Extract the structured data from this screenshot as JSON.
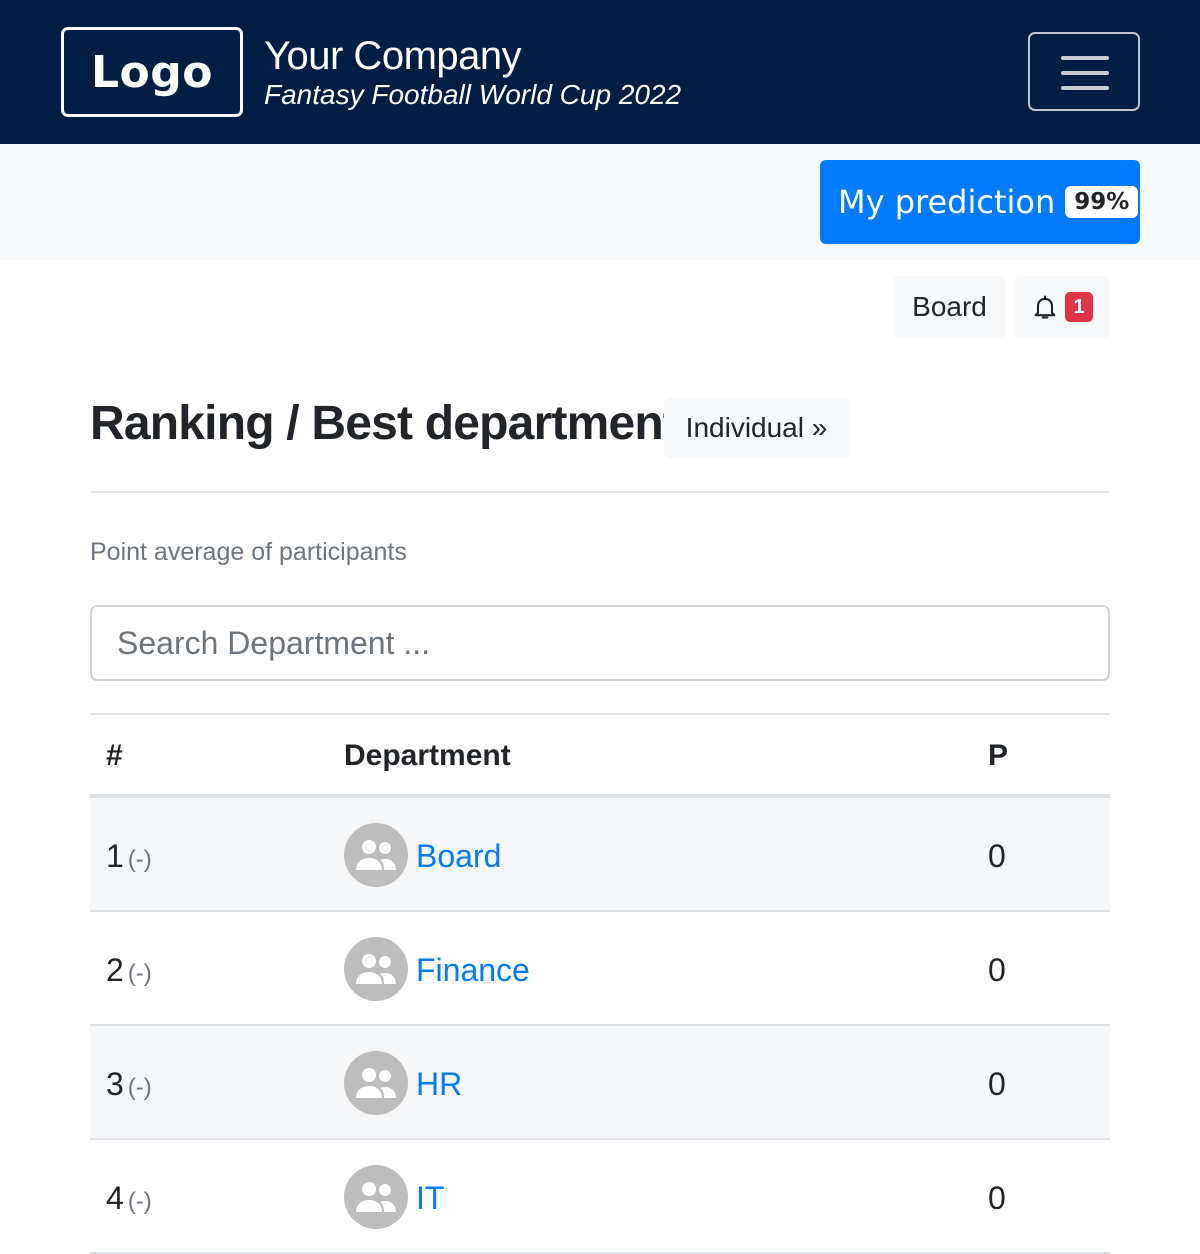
{
  "header": {
    "logo_text": "Logo",
    "company": "Your Company",
    "subtitle": "Fantasy Football World Cup 2022",
    "menu_icon": "hamburger-icon"
  },
  "subbar": {
    "prediction_label": "My prediction",
    "prediction_percent": "99%"
  },
  "actions": {
    "board_label": "Board",
    "notification_icon": "bell-icon",
    "notification_count": "1"
  },
  "page": {
    "title": "Ranking / Best department",
    "individual_link": "Individual »",
    "description": "Point average of participants",
    "search_placeholder": "Search Department ...",
    "search_value": ""
  },
  "table": {
    "headers": {
      "rank": "#",
      "department": "Department",
      "points": "P"
    },
    "rows": [
      {
        "rank": "1",
        "change": "(-)",
        "department": "Board",
        "points": "0",
        "icon": "group-icon"
      },
      {
        "rank": "2",
        "change": "(-)",
        "department": "Finance",
        "points": "0",
        "icon": "group-icon"
      },
      {
        "rank": "3",
        "change": "(-)",
        "department": "HR",
        "points": "0",
        "icon": "group-icon"
      },
      {
        "rank": "4",
        "change": "(-)",
        "department": "IT",
        "points": "0",
        "icon": "group-icon"
      }
    ]
  },
  "colors": {
    "navbar": "#001e44",
    "primary": "#007bff",
    "danger": "#dc3545",
    "light": "#f8f9fa"
  }
}
